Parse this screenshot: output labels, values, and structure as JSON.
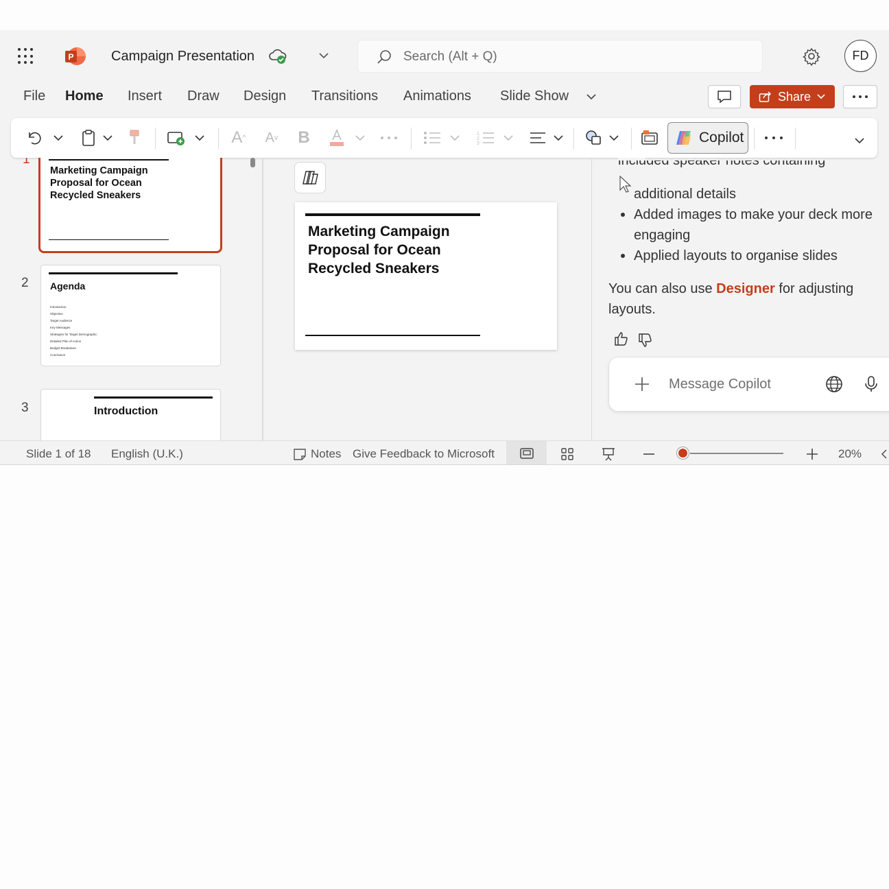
{
  "titlebar": {
    "app_icon_letter": "P",
    "document_title": "Campaign Presentation",
    "search_placeholder": "Search (Alt + Q)",
    "avatar_initials": "FD"
  },
  "menu": {
    "tabs": [
      "File",
      "Home",
      "Insert",
      "Draw",
      "Design",
      "Transitions",
      "Animations",
      "Slide Show"
    ],
    "active_tab": "Home",
    "share_label": "Share"
  },
  "toolbar": {
    "copilot_label": "Copilot",
    "font_color_swatch": "#f4a7a0"
  },
  "slides": {
    "thumbnails": [
      {
        "number": "1",
        "title": "Marketing Campaign Proposal for Ocean Recycled Sneakers"
      },
      {
        "number": "2",
        "title": "Agenda",
        "items": [
          "Introduction",
          "Objective",
          "Target Audience",
          "Key Messages",
          "Strategies for Target Demographic",
          "Detailed Plan of Action",
          "Budget Breakdown",
          "Conclusion"
        ]
      },
      {
        "number": "3",
        "title": "Introduction"
      }
    ],
    "current_title": "Marketing Campaign Proposal for Ocean Recycled Sneakers"
  },
  "copilot": {
    "partial_line": "included speaker notes containing",
    "bullet_cont": "additional details",
    "bullets": [
      "Added images to make your deck more engaging",
      "Applied layouts to organise slides"
    ],
    "designer_pre": "You can also use ",
    "designer_link": "Designer",
    "designer_post": " for adjusting layouts.",
    "message_placeholder": "Message Copilot"
  },
  "statusbar": {
    "slide_info": "Slide 1 of 18",
    "language": "English (U.K.)",
    "notes_label": "Notes",
    "feedback_label": "Give Feedback to Microsoft",
    "zoom": "20%",
    "zoom_fraction": 0.2
  },
  "colors": {
    "accent": "#c43e1c",
    "sync_ok": "#3b9b4a"
  }
}
